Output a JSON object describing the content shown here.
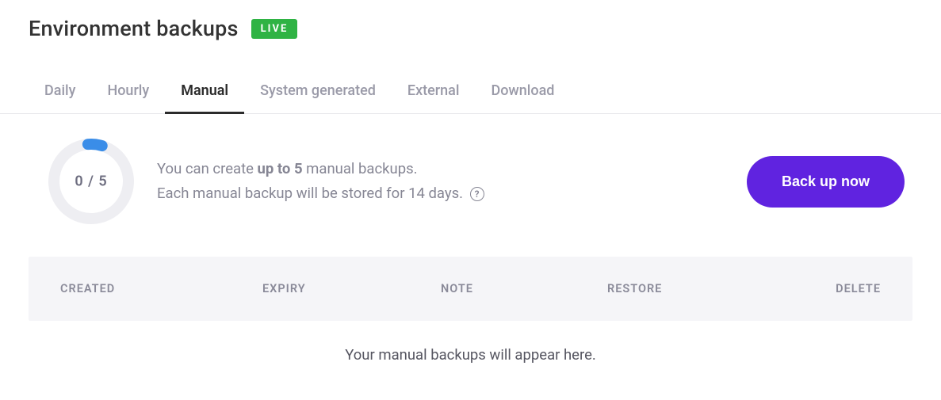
{
  "header": {
    "title": "Environment backups",
    "badge": "LIVE"
  },
  "tabs": [
    {
      "label": "Daily",
      "active": false
    },
    {
      "label": "Hourly",
      "active": false
    },
    {
      "label": "Manual",
      "active": true
    },
    {
      "label": "System generated",
      "active": false
    },
    {
      "label": "External",
      "active": false
    },
    {
      "label": "Download",
      "active": false
    }
  ],
  "usage": {
    "current": 0,
    "max": 5,
    "display": "0 / 5"
  },
  "info": {
    "line1_pre": "You can create ",
    "line1_bold": "up to 5",
    "line1_post": " manual backups.",
    "line2": "Each manual backup will be stored for 14 days."
  },
  "cta": {
    "backup_now": "Back up now"
  },
  "table": {
    "columns": {
      "created": "CREATED",
      "expiry": "EXPIRY",
      "note": "NOTE",
      "restore": "RESTORE",
      "delete": "DELETE"
    },
    "empty_message": "Your manual backups will appear here."
  },
  "colors": {
    "accent": "#6023e0",
    "live_badge": "#2fb344",
    "progress_indicator": "#3a8de8"
  }
}
